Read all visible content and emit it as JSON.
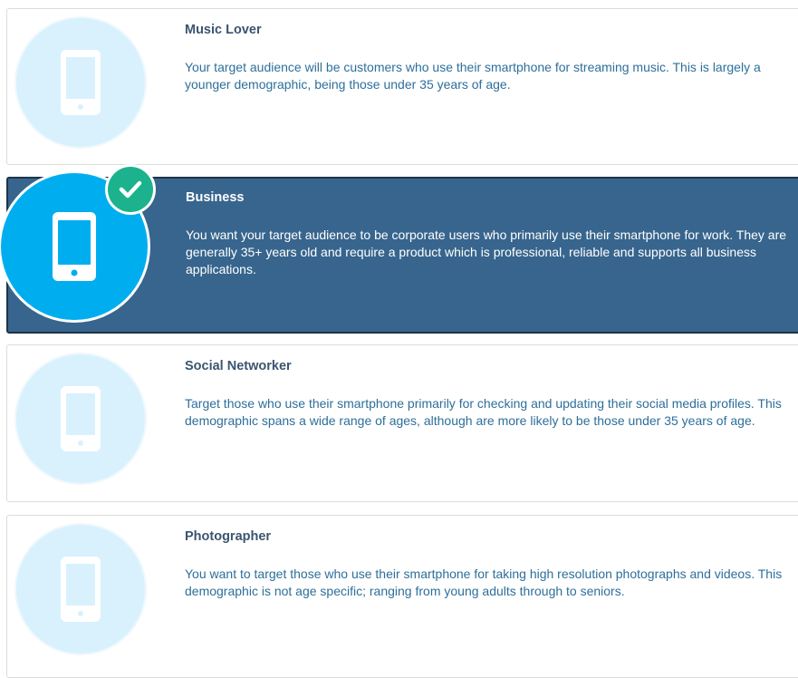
{
  "colors": {
    "selected_bg": "#37658d",
    "icon_circle_light": "#d9f1fd",
    "icon_circle_selected": "#00aeef",
    "check_badge": "#1cb28e",
    "title_text": "#3b5570",
    "body_text": "#2d6f9a"
  },
  "options": [
    {
      "title": "Music Lover",
      "description": "Your target audience will be customers who use their smartphone for streaming music. This is largely a younger demographic, being those under 35 years of age.",
      "icon": "smartphone-icon",
      "selected": false
    },
    {
      "title": "Business",
      "description": "You want your target audience to be corporate users who primarily use their smartphone for work. They are generally 35+ years old and require a product which is professional, reliable and supports all business applications.",
      "icon": "smartphone-icon",
      "selected": true
    },
    {
      "title": "Social Networker",
      "description": "Target those who use their smartphone primarily for checking and updating their social media profiles. This demographic spans a wide range of ages, although are more likely to be those under 35 years of age.",
      "icon": "smartphone-icon",
      "selected": false
    },
    {
      "title": "Photographer",
      "description": "You want to target those who use their smartphone for taking high resolution photographs and videos. This demographic is not age specific; ranging from young adults through to seniors.",
      "icon": "smartphone-icon",
      "selected": false
    }
  ]
}
